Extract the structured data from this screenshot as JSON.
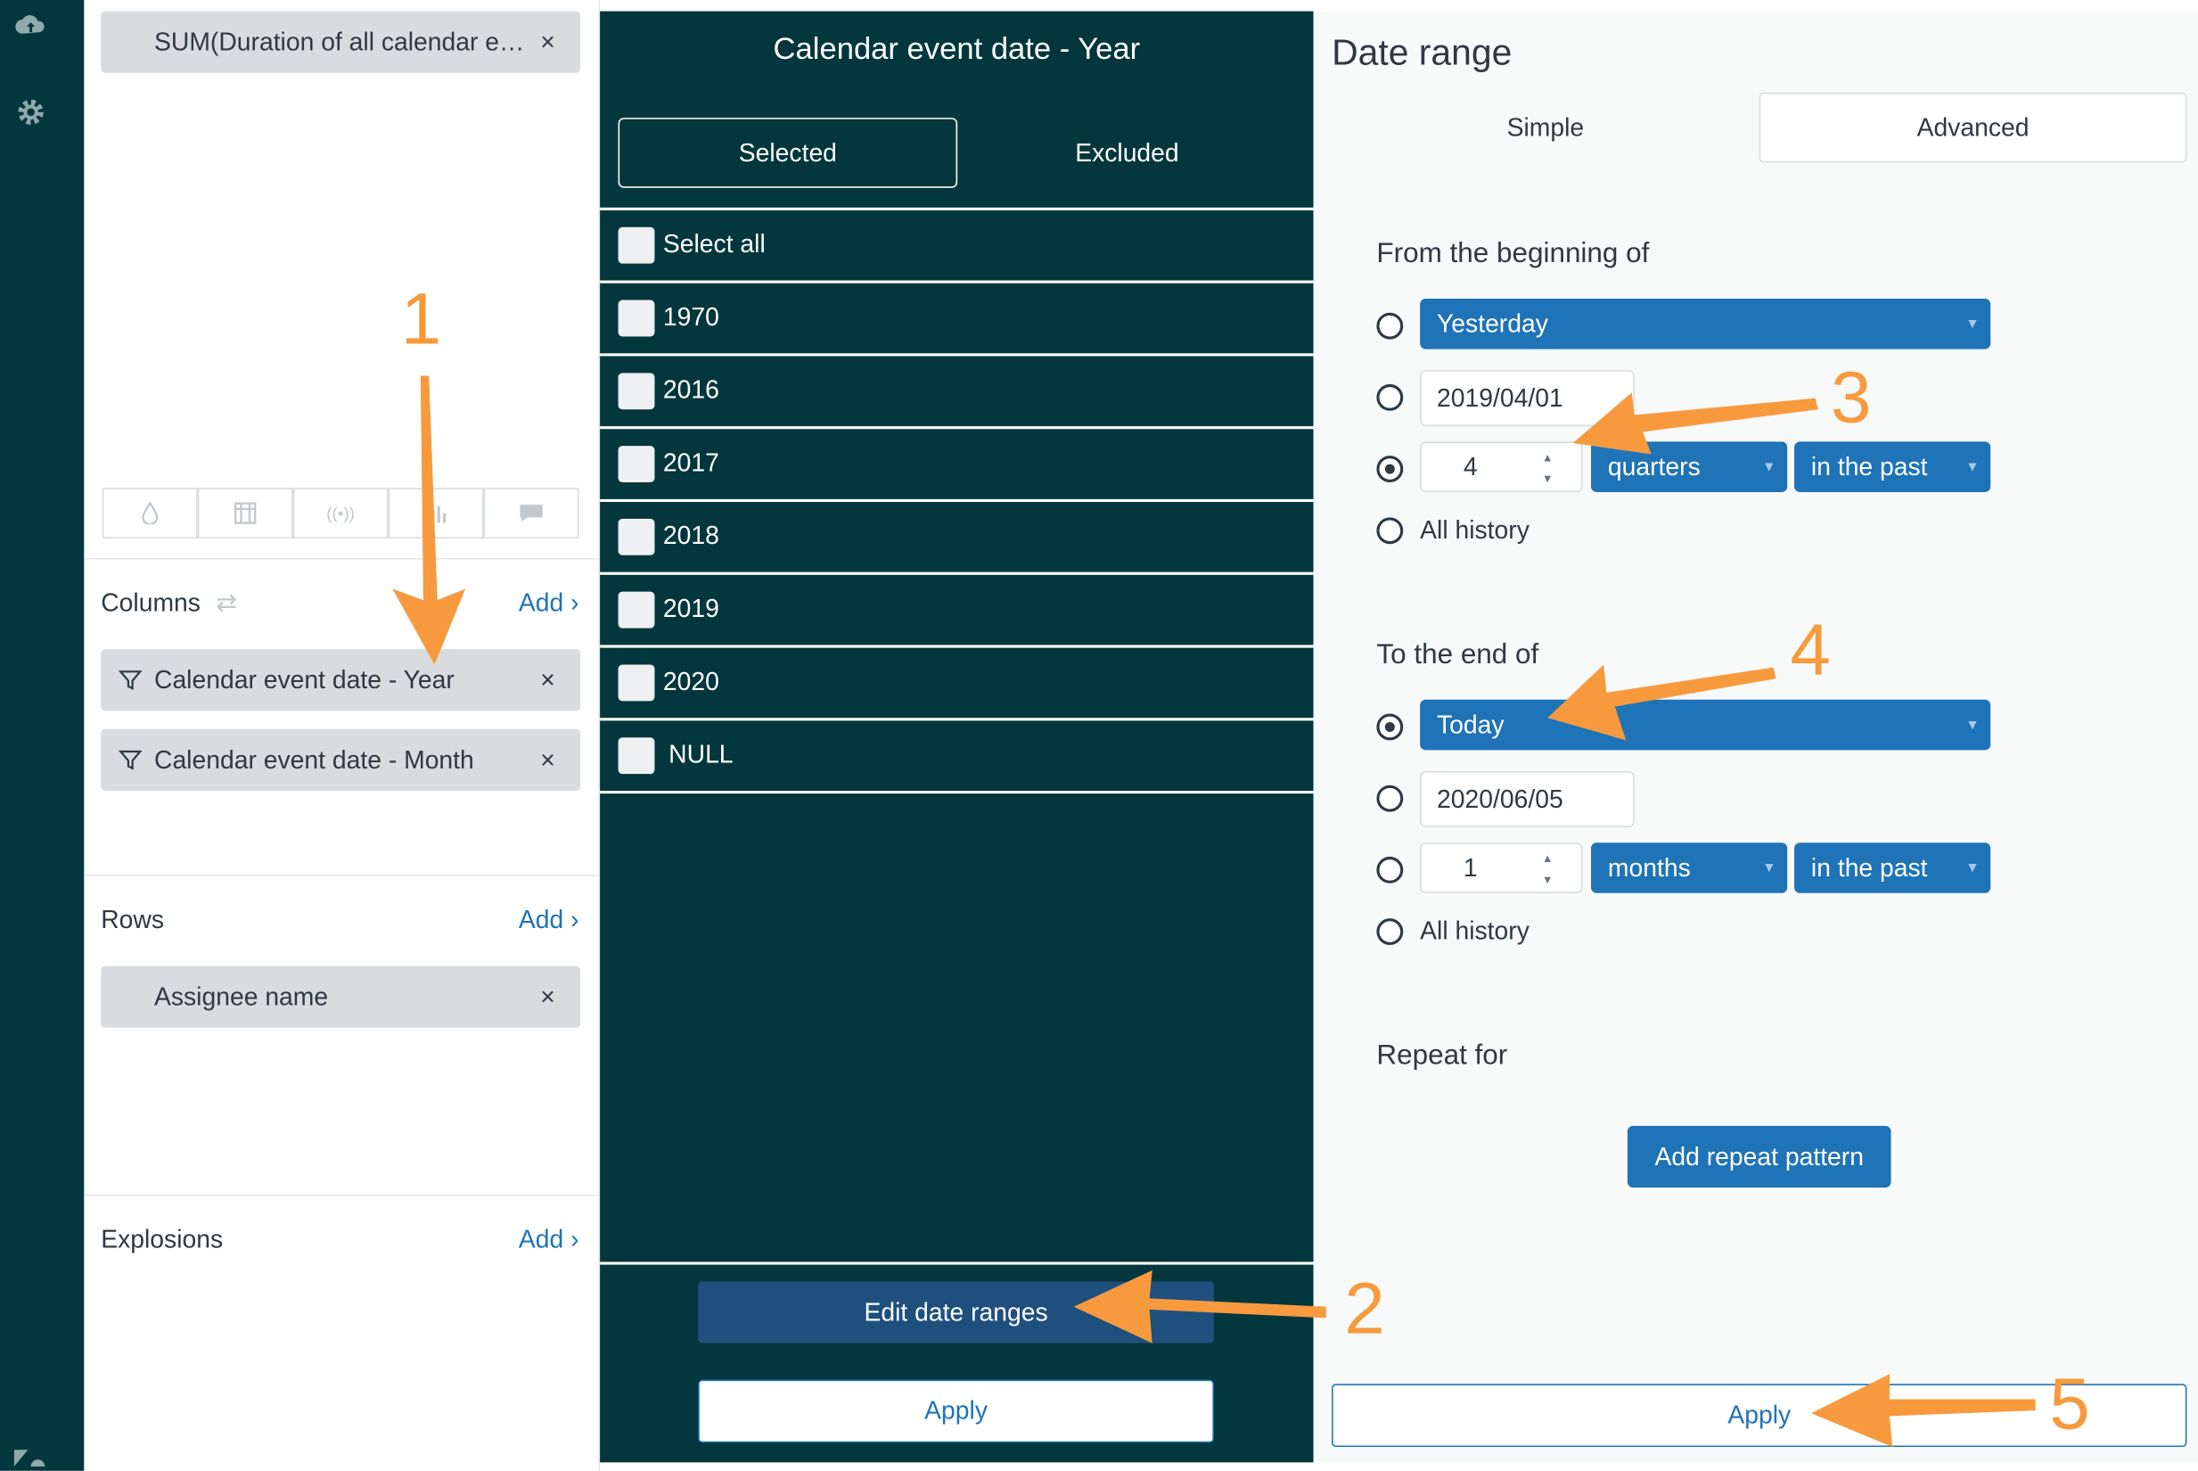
{
  "rail": {
    "icons": [
      "cloud-upload-icon",
      "gear-icon",
      "zendesk-logo"
    ]
  },
  "left": {
    "metric_pill": "SUM(Duration of all calendar e…",
    "viz_icons": [
      "drop-icon",
      "table-icon",
      "broadcast-icon",
      "chart-icon",
      "comment-icon"
    ],
    "columns": {
      "title": "Columns",
      "add": "Add ›",
      "items": [
        "Calendar event date - Year",
        "Calendar event date - Month"
      ]
    },
    "rows": {
      "title": "Rows",
      "add": "Add ›",
      "items": [
        "Assignee name"
      ]
    },
    "explosions": {
      "title": "Explosions",
      "add": "Add ›"
    },
    "close": "×"
  },
  "middle": {
    "title": "Calendar event date - Year",
    "tabs": {
      "selected": "Selected",
      "excluded": "Excluded"
    },
    "options": [
      "Select all",
      "1970",
      "2016",
      "2017",
      "2018",
      "2019",
      "2020",
      "NULL"
    ],
    "edit_button": "Edit date ranges",
    "apply_button": "Apply"
  },
  "right": {
    "title": "Date range",
    "tabs": {
      "simple": "Simple",
      "advanced": "Advanced"
    },
    "from": {
      "heading": "From the beginning of",
      "preset": "Yesterday",
      "date": "2019/04/01",
      "number": "4",
      "unit": "quarters",
      "direction": "in the past",
      "all": "All history"
    },
    "to": {
      "heading": "To the end of",
      "preset": "Today",
      "date": "2020/06/05",
      "number": "1",
      "unit": "months",
      "direction": "in the past",
      "all": "All history"
    },
    "repeat": {
      "heading": "Repeat for",
      "button": "Add repeat pattern"
    },
    "apply_button": "Apply"
  },
  "annotations": [
    "1",
    "2",
    "3",
    "4",
    "5"
  ],
  "colors": {
    "dark": "#03363d",
    "blue": "#1f73b7",
    "orange": "#f79a3e",
    "pill": "#d8dcde"
  }
}
